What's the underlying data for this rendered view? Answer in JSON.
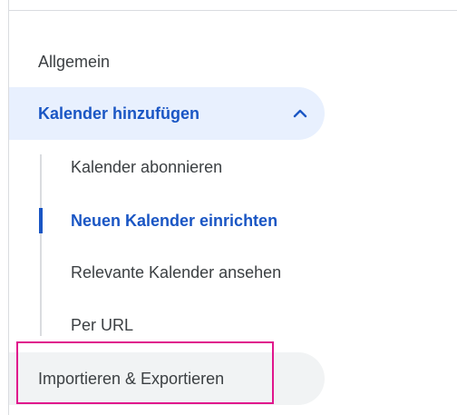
{
  "nav": {
    "general_label": "Allgemein",
    "add_calendar_label": "Kalender hinzufügen",
    "import_export_label": "Importieren & Exportieren"
  },
  "submenu": {
    "items": [
      {
        "label": "Kalender abonnieren"
      },
      {
        "label": "Neuen Kalender einrichten",
        "active": true
      },
      {
        "label": "Relevante Kalender ansehen"
      },
      {
        "label": "Per URL"
      }
    ]
  },
  "icons": {
    "expand": "chevron-up-icon"
  },
  "colors": {
    "accent": "#1a56c4",
    "selected_bg": "#e8f0fe",
    "hover_bg": "#f1f3f4",
    "highlight": "#e0168c",
    "text": "#3c4043"
  }
}
